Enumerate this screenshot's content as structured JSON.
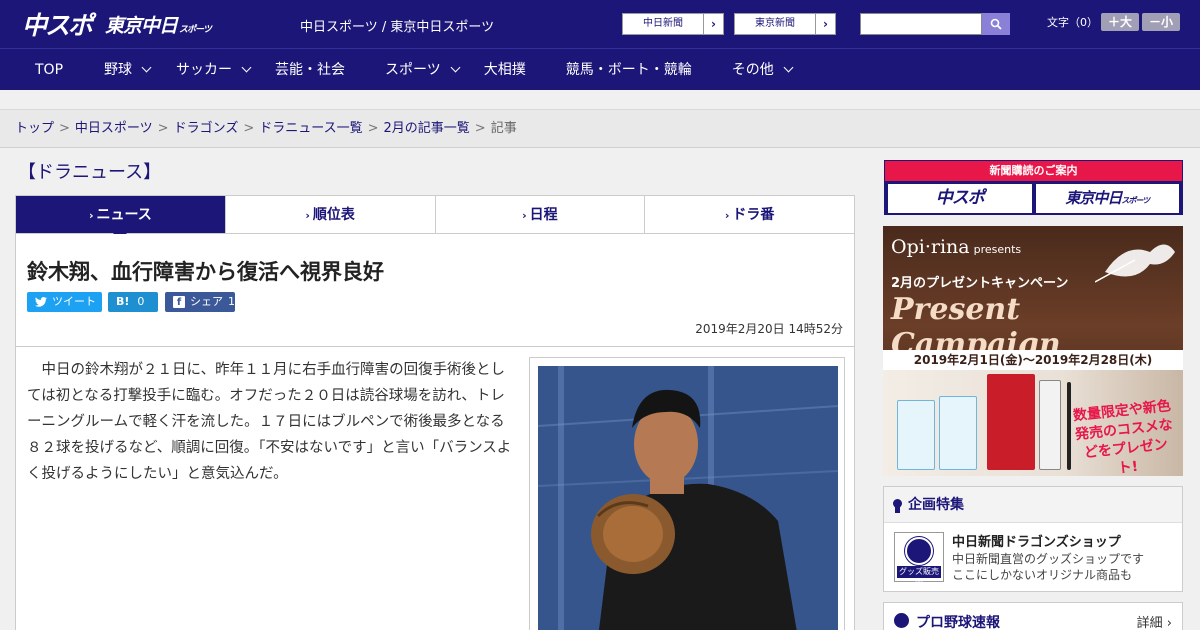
{
  "header": {
    "logo_main": "中スポ",
    "logo_sub": "東京中日",
    "logo_sub_small": "スポーツ",
    "site_links": "中日スポーツ / 東京中日スポーツ",
    "ext_buttons": [
      {
        "label": "中日新聞",
        "arrow": "›"
      },
      {
        "label": "東京新聞",
        "arrow": "›"
      }
    ],
    "search_placeholder": "",
    "font_size_label": "文字（0）",
    "font_bigger": "＋大",
    "font_smaller": "－小"
  },
  "nav": [
    {
      "label": "TOP",
      "has_dropdown": false
    },
    {
      "label": "野球",
      "has_dropdown": true
    },
    {
      "label": "サッカー",
      "has_dropdown": true
    },
    {
      "label": "芸能・社会",
      "has_dropdown": false
    },
    {
      "label": "スポーツ",
      "has_dropdown": true
    },
    {
      "label": "大相撲",
      "has_dropdown": false
    },
    {
      "label": "競馬・ボート・競輪",
      "has_dropdown": false
    },
    {
      "label": "その他",
      "has_dropdown": true
    }
  ],
  "breadcrumb": {
    "links": [
      "トップ",
      "中日スポーツ",
      "ドラゴンズ",
      "ドラニュース一覧",
      "2月の記事一覧"
    ],
    "current": "記事",
    "separator": ">"
  },
  "section_title": "【ドラニュース】",
  "tabs": [
    {
      "label": "ニュース",
      "active": true
    },
    {
      "label": "順位表",
      "active": false
    },
    {
      "label": "日程",
      "active": false
    },
    {
      "label": "ドラ番",
      "active": false
    }
  ],
  "article": {
    "headline": "鈴木翔、血行障害から復活へ視界良好",
    "share": {
      "tweet_label": "ツイート",
      "hatena_label": "B!",
      "hatena_count": "0",
      "facebook_label": "シェア",
      "facebook_count": "1"
    },
    "date": "2019年2月20日 14時52分",
    "body": "中日の鈴木翔が２１日に、昨年１１月に右手血行障害の回復手術後としては初となる打撃投手に臨む。オフだった２０日は読谷球場を訪れ、トレーニングルームで軽く汗を流した。１７日にはブルペンで術後最多となる８２球を投げるなど、順調に回復。「不安はないです」と言い「バランスよく投げるようにしたい」と意気込んだ。"
  },
  "sidebar": {
    "subscription": {
      "title": "新聞購読のご案内",
      "card_a": "中スポ",
      "card_b": "東京中日",
      "card_b_small": "スポーツ"
    },
    "ad": {
      "brand": "Opi·rina",
      "brand_small": "presents",
      "campaign": "2月のプレゼントキャンペーン",
      "script": "Present Campaign",
      "date_range": "2019年2月1日(金)～2019年2月28日(木)",
      "promo": "数量限定や新色発売のコスメなどをプレゼント!"
    },
    "feature": {
      "heading": "企画特集",
      "thumb_band": "グッズ販売中",
      "title": "中日新聞ドラゴンズショップ",
      "desc_line1": "中日新聞直営のグッズショップです",
      "desc_line2": "ここにしかないオリジナル商品も"
    },
    "baseball": {
      "title": "プロ野球速報",
      "more": "詳細 ›"
    }
  }
}
